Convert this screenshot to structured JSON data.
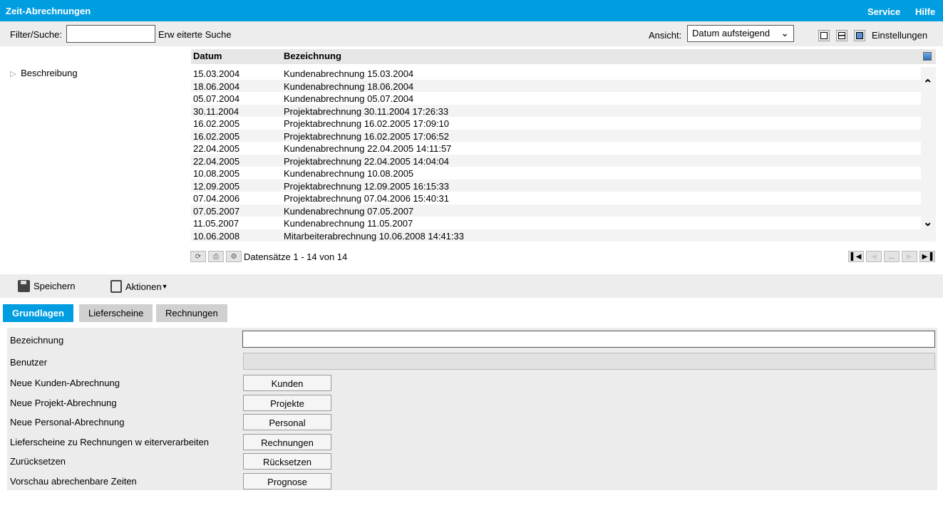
{
  "header": {
    "title": "Zeit-Abrechnungen",
    "service": "Service",
    "help": "Hilfe"
  },
  "toolbar": {
    "filter_label": "Filter/Suche:",
    "filter_value": "",
    "advanced_search": "Erw eiterte Suche",
    "view_label": "Ansicht:",
    "view_value": "Datum aufsteigend",
    "settings": "Einstellungen"
  },
  "sidebar": {
    "description": "Beschreibung"
  },
  "grid": {
    "columns": [
      "Datum",
      "Bezeichnung"
    ],
    "rows": [
      [
        "15.03.2004",
        "Kundenabrechnung 15.03.2004"
      ],
      [
        "18.06.2004",
        "Kundenabrechnung 18.06.2004"
      ],
      [
        "05.07.2004",
        "Kundenabrechnung 05.07.2004"
      ],
      [
        "30.11.2004",
        "Projektabrechnung 30.11.2004 17:26:33"
      ],
      [
        "16.02.2005",
        "Projektabrechnung 16.02.2005 17:09:10"
      ],
      [
        "16.02.2005",
        "Projektabrechnung 16.02.2005 17:06:52"
      ],
      [
        "22.04.2005",
        "Kundenabrechnung 22.04.2005 14:11:57"
      ],
      [
        "22.04.2005",
        "Projektabrechnung 22.04.2005 14:04:04"
      ],
      [
        "10.08.2005",
        "Kundenabrechnung 10.08.2005"
      ],
      [
        "12.09.2005",
        "Projektabrechnung 12.09.2005 16:15:33"
      ],
      [
        "07.04.2006",
        "Projektabrechnung 07.04.2006 15:40:31"
      ],
      [
        "07.05.2007",
        "Kundenabrechnung 07.05.2007"
      ],
      [
        "11.05.2007",
        "Kundenabrechnung 11.05.2007"
      ],
      [
        "10.06.2008",
        "Mitarbeiterabrechnung 10.06.2008 14:41:33"
      ]
    ],
    "records": "Datensätze 1 - 14 von 14",
    "pager_more": "..."
  },
  "actions": {
    "save": "Speichern",
    "actions": "Aktionen"
  },
  "tabs": [
    "Grundlagen",
    "Lieferscheine",
    "Rechnungen"
  ],
  "form": {
    "bezeichnung_label": "Bezeichnung",
    "bezeichnung_value": "",
    "benutzer_label": "Benutzer",
    "benutzer_value": "",
    "rows": [
      {
        "label": "Neue Kunden-Abrechnung",
        "button": "Kunden"
      },
      {
        "label": "Neue Projekt-Abrechnung",
        "button": "Projekte"
      },
      {
        "label": "Neue Personal-Abrechnung",
        "button": "Personal"
      },
      {
        "label": "Lieferscheine zu Rechnungen w eiterverarbeiten",
        "button": "Rechnungen"
      },
      {
        "label": "Zurücksetzen",
        "button": "Rücksetzen"
      },
      {
        "label": "Vorschau abrechenbare Zeiten",
        "button": "Prognose"
      }
    ]
  },
  "colors": {
    "brand": "#009ee0"
  }
}
